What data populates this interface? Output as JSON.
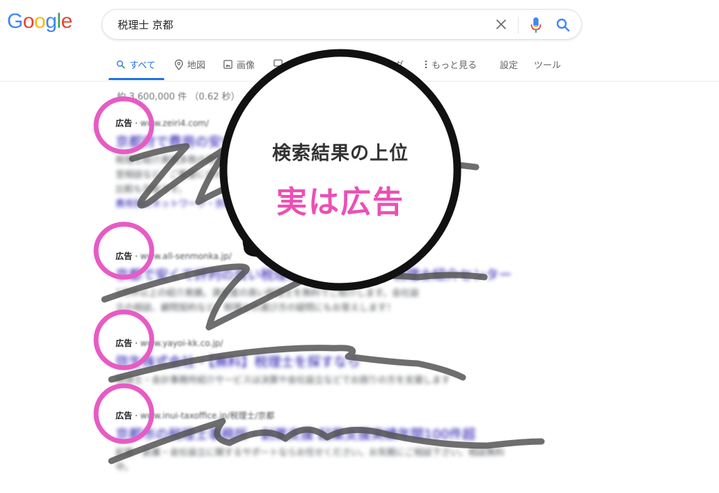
{
  "header": {
    "logo_letters": [
      {
        "ch": "G",
        "color": "#4285F4"
      },
      {
        "ch": "o",
        "color": "#EA4335"
      },
      {
        "ch": "o",
        "color": "#FBBC05"
      },
      {
        "ch": "g",
        "color": "#4285F4"
      },
      {
        "ch": "l",
        "color": "#34A853"
      },
      {
        "ch": "e",
        "color": "#EA4335"
      }
    ],
    "query": "税理士 京都"
  },
  "tabs": [
    {
      "label": "すべて",
      "icon": "search-icon",
      "active": true
    },
    {
      "label": "地図",
      "icon": "map-pin-icon"
    },
    {
      "label": "画像",
      "icon": "image-icon"
    },
    {
      "label": "グ",
      "icon": "shopping-icon"
    },
    {
      "label": "もっと見る",
      "icon": "more-vert-icon"
    },
    {
      "label": "設定"
    },
    {
      "label": "ツール"
    }
  ],
  "stats": "約 3,600,000 件 （0.62 秒）",
  "results": [
    {
      "ad_label": "広告",
      "url": "www.zeiri4.com/",
      "title": "京都府で費用の安い税理士をお探しなら",
      "desc": [
        "税理士紹介実績多数の専門家をご紹介。記帳代行、確定申告、顧問契約、経",
        "営相談など、ご要望に合わせて最適な税理士をお探しします。料金",
        "比較も可能です。"
      ],
      "sub": "費用別にネットワーク・京都府の税理士事務所一覧を探す"
    },
    {
      "ad_label": "広告",
      "url": "www.all-senmonka.jp/",
      "title": "京都で安くて評判の良い税理士をお探しなら・税理士紹介センター",
      "desc": [
        "1万件以上の紹介実績。満足度の高い税理士を無料でご紹介します。会社設",
        "立の相談、顧問契約など、税理士の選び方の疑問にもお答えします！"
      ]
    },
    {
      "ad_label": "広告",
      "url": "www.yayoi-kk.co.jp/",
      "title": "弥生株式会社・【無料】税理士を探すなら",
      "desc": [
        "税理士・会計事務所紹介サービスは決算や会社設立などでお困りの方を支援します"
      ]
    },
    {
      "ad_label": "広告",
      "url": "www.inui-taxoffice.jp/税理士/京都",
      "title": "京都市の税理士事務所・創業支援 起業支援実績年間100件超",
      "desc": [
        "起業・創業・会社設立に関するサポートならお任せください。お気軽にご相談下さい。相談無料",
        "中。"
      ]
    }
  ],
  "overlay": {
    "line1": "検索結果の上位",
    "line2": "実は広告",
    "accent": "#ec4fb5",
    "circle_color": "#e75bc4"
  }
}
